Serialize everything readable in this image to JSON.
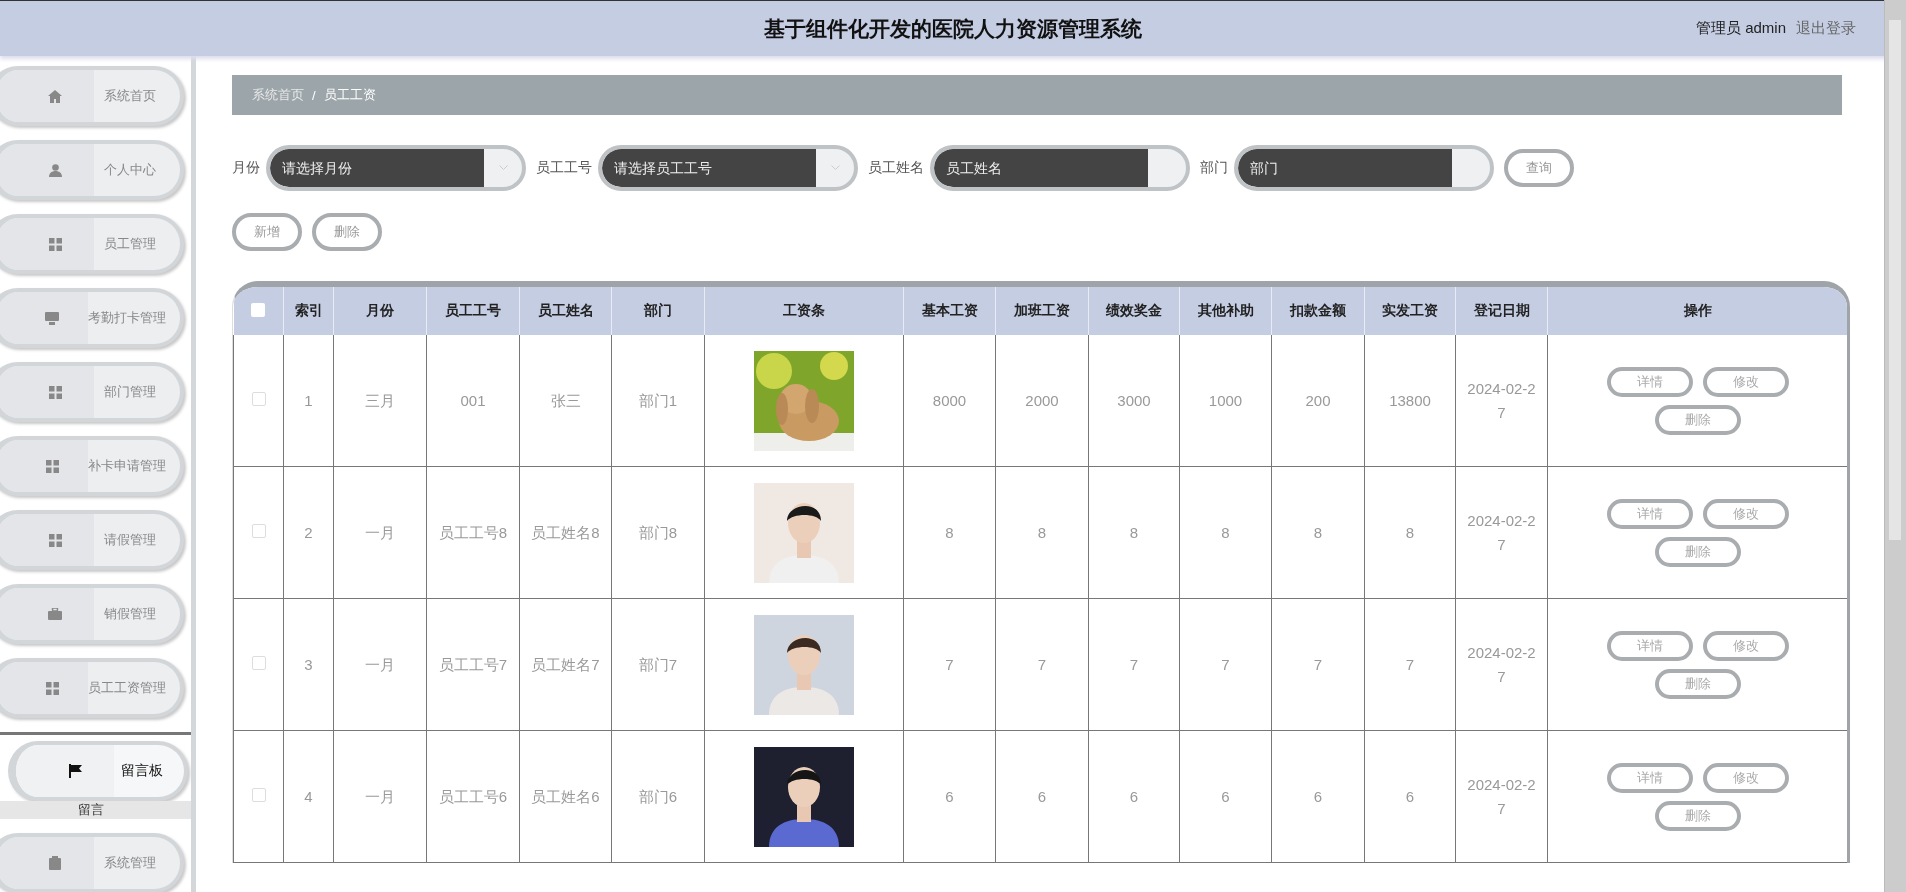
{
  "header": {
    "title": "基于组件化开发的医院人力资源管理系统",
    "user": "管理员 admin",
    "logout": "退出登录"
  },
  "sidebar": {
    "items": [
      {
        "label": "系统首页",
        "kind": "home",
        "expanded": false
      },
      {
        "label": "个人中心",
        "kind": "person",
        "expanded": false
      },
      {
        "label": "员工管理",
        "kind": "grid",
        "expanded": false
      },
      {
        "label": "考勤打卡管理",
        "kind": "monitor",
        "expanded": false
      },
      {
        "label": "部门管理",
        "kind": "grid",
        "expanded": false
      },
      {
        "label": "补卡申请管理",
        "kind": "grid",
        "expanded": false
      },
      {
        "label": "请假管理",
        "kind": "grid",
        "expanded": false
      },
      {
        "label": "销假管理",
        "kind": "briefcase",
        "expanded": false
      },
      {
        "label": "员工工资管理",
        "kind": "grid",
        "expanded": false
      },
      {
        "label": "留言板",
        "kind": "flag",
        "expanded": true,
        "children": [
          {
            "label": "留言"
          }
        ]
      },
      {
        "label": "系统管理",
        "kind": "clipboard",
        "expanded": false
      }
    ]
  },
  "breadcrumb": [
    "系统首页",
    "/",
    "员工工资"
  ],
  "filters": [
    {
      "label": "月份",
      "placeholder": "请选择月份",
      "kind": "select"
    },
    {
      "label": "员工工号",
      "placeholder": "请选择员工工号",
      "kind": "select"
    },
    {
      "label": "员工姓名",
      "placeholder": "员工姓名",
      "kind": "text"
    },
    {
      "label": "部门",
      "placeholder": "部门",
      "kind": "text"
    }
  ],
  "search_button": "查询",
  "actions": [
    "新增",
    "删除"
  ],
  "table": {
    "select_all_checked": false,
    "columns": [
      "索引",
      "月份",
      "员工工号",
      "员工姓名",
      "部门",
      "工资条",
      "基本工资",
      "加班工资",
      "绩效奖金",
      "其他补助",
      "扣款金额",
      "实发工资",
      "登记日期",
      "操作"
    ],
    "rows": [
      {
        "checked": false,
        "cells": [
          "1",
          "三月",
          "001",
          "张三",
          "部门1"
        ],
        "payslip": {
          "kind": "picture"
        },
        "amounts": [
          "8000",
          "2000",
          "3000",
          "1000",
          "200",
          "13800"
        ],
        "date": "2024-02-27",
        "buttons": [
          "详情",
          "修改",
          "删除"
        ]
      },
      {
        "checked": false,
        "cells": [
          "2",
          "一月",
          "员工工号8",
          "员工姓名8",
          "部门8"
        ],
        "payslip": {
          "kind": "picture"
        },
        "amounts": [
          "8",
          "8",
          "8",
          "8",
          "8",
          "8"
        ],
        "date": "2024-02-27",
        "buttons": [
          "详情",
          "修改",
          "删除"
        ]
      },
      {
        "checked": false,
        "cells": [
          "3",
          "一月",
          "员工工号7",
          "员工姓名7",
          "部门7"
        ],
        "payslip": {
          "kind": "picture"
        },
        "amounts": [
          "7",
          "7",
          "7",
          "7",
          "7",
          "7"
        ],
        "date": "2024-02-27",
        "buttons": [
          "详情",
          "修改",
          "删除"
        ]
      },
      {
        "checked": false,
        "cells": [
          "4",
          "一月",
          "员工工号6",
          "员工姓名6",
          "部门6"
        ],
        "payslip": {
          "kind": "picture"
        },
        "amounts": [
          "6",
          "6",
          "6",
          "6",
          "6",
          "6"
        ],
        "date": "2024-02-27",
        "buttons": [
          "详情",
          "修改",
          "删除"
        ]
      }
    ]
  }
}
